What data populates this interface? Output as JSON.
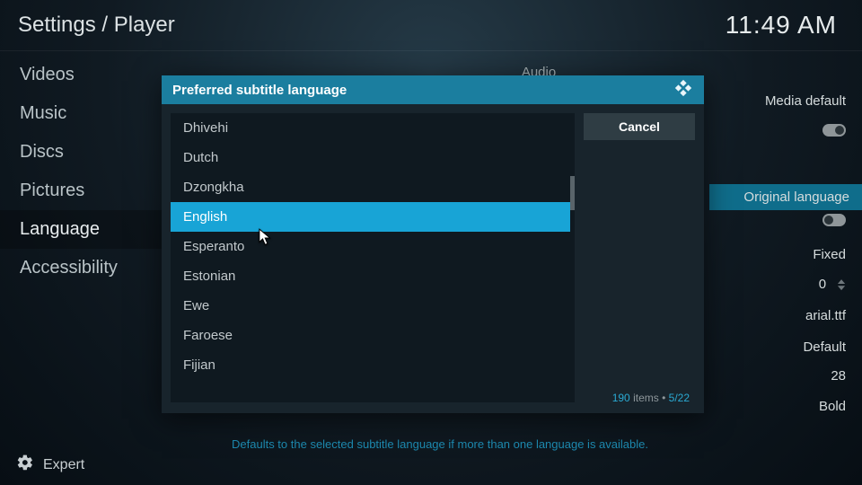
{
  "header": {
    "breadcrumb": "Settings / Player",
    "clock": "11:49 AM"
  },
  "sidebar": {
    "items": [
      {
        "label": "Videos"
      },
      {
        "label": "Music"
      },
      {
        "label": "Discs"
      },
      {
        "label": "Pictures"
      },
      {
        "label": "Language"
      },
      {
        "label": "Accessibility"
      }
    ],
    "selected_index": 4
  },
  "level": {
    "label": "Expert"
  },
  "section_title": "Audio",
  "right_settings": {
    "r1": "Media default",
    "r2": "Original language",
    "r3": "Fixed",
    "r4": "0",
    "r5": "arial.ttf",
    "r6": "Default",
    "r7": "28",
    "r8": "Bold"
  },
  "hint": "Defaults to the selected subtitle language if more than one language is available.",
  "modal": {
    "title": "Preferred subtitle language",
    "cancel": "Cancel",
    "items": [
      "Dhivehi",
      "Dutch",
      "Dzongkha",
      "English",
      "Esperanto",
      "Estonian",
      "Ewe",
      "Faroese",
      "Fijian"
    ],
    "selected_index": 3,
    "total_items": "190",
    "items_word": "items",
    "page": "5/22"
  }
}
